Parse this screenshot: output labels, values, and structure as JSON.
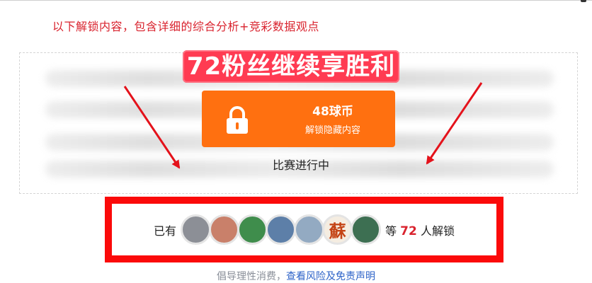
{
  "intro_text": "以下解锁内容，包含详细的综合分析+竞彩数据观点",
  "promo_banner": "72粉丝继续享胜利",
  "unlock_button": {
    "price": "48球币",
    "label": "解锁隐藏内容",
    "icon": "lock-icon"
  },
  "match_status": "比赛进行中",
  "unlocked_users": {
    "prefix": "已有",
    "avatars": [
      {
        "name": "cat-photo-avatar",
        "color": "#8c8f96"
      },
      {
        "name": "sunset-photo-avatar",
        "color": "#c9806a"
      },
      {
        "name": "gift-box-avatar",
        "color": "#3f8d4c"
      },
      {
        "name": "mountain-lake-avatar",
        "color": "#5d7fa8"
      },
      {
        "name": "person-outdoor-avatar",
        "color": "#93aac2"
      },
      {
        "name": "su-character-avatar",
        "color": "#f5ede1",
        "glyph": "蘇"
      },
      {
        "name": "soccer-players-avatar",
        "color": "#3d6f52"
      }
    ],
    "mid": "等",
    "count": "72",
    "suffix": "人解锁"
  },
  "footer": {
    "prefix": "倡导理性消费，",
    "link": "查看风险及免责声明"
  },
  "colors": {
    "red": "#d9232e",
    "orange": "#ff7010",
    "banner": "#ff3b52",
    "frame": "#fb0a0a",
    "link": "#2d63c8"
  }
}
